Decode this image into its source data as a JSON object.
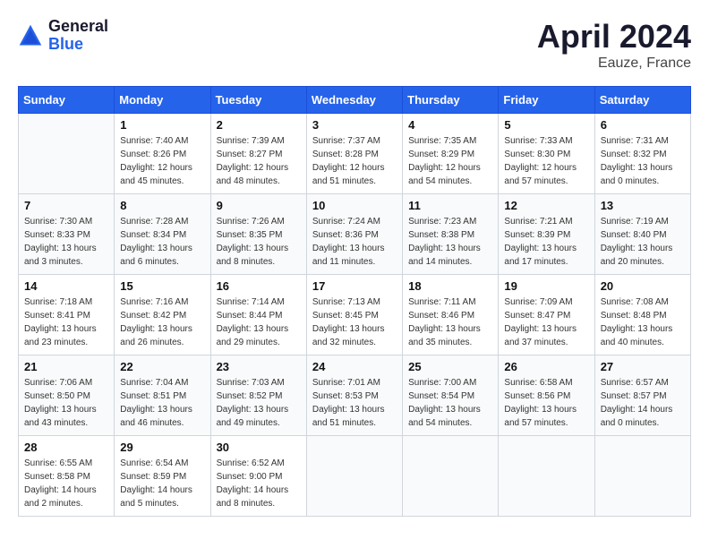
{
  "header": {
    "logo_general": "General",
    "logo_blue": "Blue",
    "month_title": "April 2024",
    "location": "Eauze, France"
  },
  "days_of_week": [
    "Sunday",
    "Monday",
    "Tuesday",
    "Wednesday",
    "Thursday",
    "Friday",
    "Saturday"
  ],
  "weeks": [
    [
      {
        "day": "",
        "sunrise": "",
        "sunset": "",
        "daylight": ""
      },
      {
        "day": "1",
        "sunrise": "Sunrise: 7:40 AM",
        "sunset": "Sunset: 8:26 PM",
        "daylight": "Daylight: 12 hours and 45 minutes."
      },
      {
        "day": "2",
        "sunrise": "Sunrise: 7:39 AM",
        "sunset": "Sunset: 8:27 PM",
        "daylight": "Daylight: 12 hours and 48 minutes."
      },
      {
        "day": "3",
        "sunrise": "Sunrise: 7:37 AM",
        "sunset": "Sunset: 8:28 PM",
        "daylight": "Daylight: 12 hours and 51 minutes."
      },
      {
        "day": "4",
        "sunrise": "Sunrise: 7:35 AM",
        "sunset": "Sunset: 8:29 PM",
        "daylight": "Daylight: 12 hours and 54 minutes."
      },
      {
        "day": "5",
        "sunrise": "Sunrise: 7:33 AM",
        "sunset": "Sunset: 8:30 PM",
        "daylight": "Daylight: 12 hours and 57 minutes."
      },
      {
        "day": "6",
        "sunrise": "Sunrise: 7:31 AM",
        "sunset": "Sunset: 8:32 PM",
        "daylight": "Daylight: 13 hours and 0 minutes."
      }
    ],
    [
      {
        "day": "7",
        "sunrise": "Sunrise: 7:30 AM",
        "sunset": "Sunset: 8:33 PM",
        "daylight": "Daylight: 13 hours and 3 minutes."
      },
      {
        "day": "8",
        "sunrise": "Sunrise: 7:28 AM",
        "sunset": "Sunset: 8:34 PM",
        "daylight": "Daylight: 13 hours and 6 minutes."
      },
      {
        "day": "9",
        "sunrise": "Sunrise: 7:26 AM",
        "sunset": "Sunset: 8:35 PM",
        "daylight": "Daylight: 13 hours and 8 minutes."
      },
      {
        "day": "10",
        "sunrise": "Sunrise: 7:24 AM",
        "sunset": "Sunset: 8:36 PM",
        "daylight": "Daylight: 13 hours and 11 minutes."
      },
      {
        "day": "11",
        "sunrise": "Sunrise: 7:23 AM",
        "sunset": "Sunset: 8:38 PM",
        "daylight": "Daylight: 13 hours and 14 minutes."
      },
      {
        "day": "12",
        "sunrise": "Sunrise: 7:21 AM",
        "sunset": "Sunset: 8:39 PM",
        "daylight": "Daylight: 13 hours and 17 minutes."
      },
      {
        "day": "13",
        "sunrise": "Sunrise: 7:19 AM",
        "sunset": "Sunset: 8:40 PM",
        "daylight": "Daylight: 13 hours and 20 minutes."
      }
    ],
    [
      {
        "day": "14",
        "sunrise": "Sunrise: 7:18 AM",
        "sunset": "Sunset: 8:41 PM",
        "daylight": "Daylight: 13 hours and 23 minutes."
      },
      {
        "day": "15",
        "sunrise": "Sunrise: 7:16 AM",
        "sunset": "Sunset: 8:42 PM",
        "daylight": "Daylight: 13 hours and 26 minutes."
      },
      {
        "day": "16",
        "sunrise": "Sunrise: 7:14 AM",
        "sunset": "Sunset: 8:44 PM",
        "daylight": "Daylight: 13 hours and 29 minutes."
      },
      {
        "day": "17",
        "sunrise": "Sunrise: 7:13 AM",
        "sunset": "Sunset: 8:45 PM",
        "daylight": "Daylight: 13 hours and 32 minutes."
      },
      {
        "day": "18",
        "sunrise": "Sunrise: 7:11 AM",
        "sunset": "Sunset: 8:46 PM",
        "daylight": "Daylight: 13 hours and 35 minutes."
      },
      {
        "day": "19",
        "sunrise": "Sunrise: 7:09 AM",
        "sunset": "Sunset: 8:47 PM",
        "daylight": "Daylight: 13 hours and 37 minutes."
      },
      {
        "day": "20",
        "sunrise": "Sunrise: 7:08 AM",
        "sunset": "Sunset: 8:48 PM",
        "daylight": "Daylight: 13 hours and 40 minutes."
      }
    ],
    [
      {
        "day": "21",
        "sunrise": "Sunrise: 7:06 AM",
        "sunset": "Sunset: 8:50 PM",
        "daylight": "Daylight: 13 hours and 43 minutes."
      },
      {
        "day": "22",
        "sunrise": "Sunrise: 7:04 AM",
        "sunset": "Sunset: 8:51 PM",
        "daylight": "Daylight: 13 hours and 46 minutes."
      },
      {
        "day": "23",
        "sunrise": "Sunrise: 7:03 AM",
        "sunset": "Sunset: 8:52 PM",
        "daylight": "Daylight: 13 hours and 49 minutes."
      },
      {
        "day": "24",
        "sunrise": "Sunrise: 7:01 AM",
        "sunset": "Sunset: 8:53 PM",
        "daylight": "Daylight: 13 hours and 51 minutes."
      },
      {
        "day": "25",
        "sunrise": "Sunrise: 7:00 AM",
        "sunset": "Sunset: 8:54 PM",
        "daylight": "Daylight: 13 hours and 54 minutes."
      },
      {
        "day": "26",
        "sunrise": "Sunrise: 6:58 AM",
        "sunset": "Sunset: 8:56 PM",
        "daylight": "Daylight: 13 hours and 57 minutes."
      },
      {
        "day": "27",
        "sunrise": "Sunrise: 6:57 AM",
        "sunset": "Sunset: 8:57 PM",
        "daylight": "Daylight: 14 hours and 0 minutes."
      }
    ],
    [
      {
        "day": "28",
        "sunrise": "Sunrise: 6:55 AM",
        "sunset": "Sunset: 8:58 PM",
        "daylight": "Daylight: 14 hours and 2 minutes."
      },
      {
        "day": "29",
        "sunrise": "Sunrise: 6:54 AM",
        "sunset": "Sunset: 8:59 PM",
        "daylight": "Daylight: 14 hours and 5 minutes."
      },
      {
        "day": "30",
        "sunrise": "Sunrise: 6:52 AM",
        "sunset": "Sunset: 9:00 PM",
        "daylight": "Daylight: 14 hours and 8 minutes."
      },
      {
        "day": "",
        "sunrise": "",
        "sunset": "",
        "daylight": ""
      },
      {
        "day": "",
        "sunrise": "",
        "sunset": "",
        "daylight": ""
      },
      {
        "day": "",
        "sunrise": "",
        "sunset": "",
        "daylight": ""
      },
      {
        "day": "",
        "sunrise": "",
        "sunset": "",
        "daylight": ""
      }
    ]
  ]
}
